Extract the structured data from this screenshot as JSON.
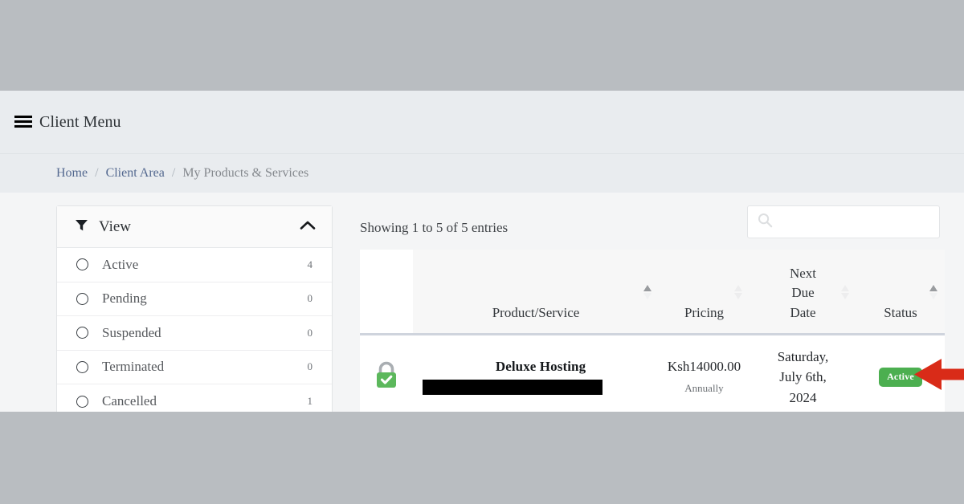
{
  "header": {
    "menu_icon": "hamburger-icon",
    "menu_label": "Client Menu"
  },
  "breadcrumb": {
    "items": [
      {
        "label": "Home",
        "type": "link"
      },
      {
        "label": "Client Area",
        "type": "link"
      },
      {
        "label": "My Products & Services",
        "type": "current"
      }
    ],
    "separator": "/"
  },
  "filter_panel": {
    "icon": "funnel-icon",
    "title": "View",
    "collapse_icon": "chevron-up-icon",
    "items": [
      {
        "label": "Active",
        "count": "4"
      },
      {
        "label": "Pending",
        "count": "0"
      },
      {
        "label": "Suspended",
        "count": "0"
      },
      {
        "label": "Terminated",
        "count": "0"
      },
      {
        "label": "Cancelled",
        "count": "1"
      }
    ]
  },
  "table_toolbar": {
    "entries_info": "Showing 1 to 5 of  5 entries",
    "search_placeholder": "",
    "search_value": "",
    "search_icon": "search-icon"
  },
  "table": {
    "columns": [
      {
        "label": "",
        "sort": "none"
      },
      {
        "label": "Product/Service",
        "sort": "asc"
      },
      {
        "label": "Pricing",
        "sort": "none"
      },
      {
        "label": "Next Due Date",
        "sort": "none"
      },
      {
        "label": "Status",
        "sort": "asc"
      }
    ],
    "column_next_due_lines": [
      "Next",
      "Due",
      "Date"
    ],
    "rows": [
      {
        "icon": "green-padlock-icon",
        "product_name": "Deluxe Hosting",
        "domain_redacted": true,
        "price": "Ksh14000.00",
        "billing_cycle": "Annually",
        "next_due_date": [
          "Saturday,",
          "July 6th,",
          "2024"
        ],
        "status": "Active"
      }
    ]
  },
  "annotation": {
    "arrow": "left-pointing-arrow",
    "arrow_color": "#d92b18",
    "points_at": "status-badge"
  },
  "colors": {
    "status_active": "#4caf50",
    "link": "#53688f",
    "page_background": "#f4f5f6",
    "header_background": "#e9ecef",
    "letterbox": "#b9bdc1"
  }
}
